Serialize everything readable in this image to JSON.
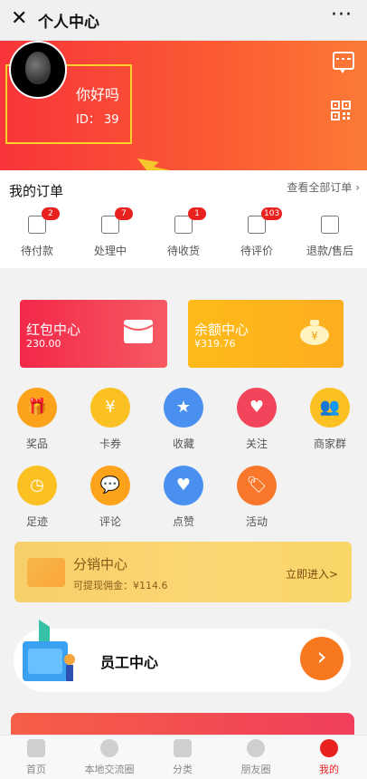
{
  "topbar": {
    "close": "✕",
    "title": "个人中心",
    "more": "···"
  },
  "profile": {
    "name": "你好吗",
    "id": "ID：  39"
  },
  "orders": {
    "title": "我的订单",
    "view_all": "查看全部订单 ›",
    "items": [
      {
        "label": "待付款",
        "badge": "2"
      },
      {
        "label": "处理中",
        "badge": "7"
      },
      {
        "label": "待收货",
        "badge": "1"
      },
      {
        "label": "待评价",
        "badge": "103"
      },
      {
        "label": "退款/售后",
        "badge": ""
      }
    ]
  },
  "cards": [
    {
      "title": "红包中心",
      "value": "230.00"
    },
    {
      "title": "余额中心",
      "value": "¥319.76"
    }
  ],
  "grid": [
    {
      "label": "奖品",
      "icon": "gift-icon",
      "color": "#fca21b"
    },
    {
      "label": "卡券",
      "icon": "coupon-icon",
      "color": "#fbc022"
    },
    {
      "label": "收藏",
      "icon": "star-icon",
      "color": "#4a90f0"
    },
    {
      "label": "关注",
      "icon": "heart-plus-icon",
      "color": "#f2455b"
    },
    {
      "label": "商家群",
      "icon": "group-icon",
      "color": "#fbc022"
    },
    {
      "label": "足迹",
      "icon": "clock-icon",
      "color": "#fbc022"
    },
    {
      "label": "评论",
      "icon": "comment-icon",
      "color": "#fca21b"
    },
    {
      "label": "点赞",
      "icon": "like-heart-icon",
      "color": "#4a90f0"
    },
    {
      "label": "活动",
      "icon": "tag-icon",
      "color": "#f8772a"
    }
  ],
  "distribution": {
    "title": "分销中心",
    "sub": "可提现佣金：¥114.6",
    "action": "立即进入>"
  },
  "staff": {
    "title": "员工中心",
    "button": "›"
  },
  "tabs": [
    {
      "label": "首页"
    },
    {
      "label": "本地交流圈"
    },
    {
      "label": "分类"
    },
    {
      "label": "朋友圈"
    },
    {
      "label": "我的"
    }
  ]
}
